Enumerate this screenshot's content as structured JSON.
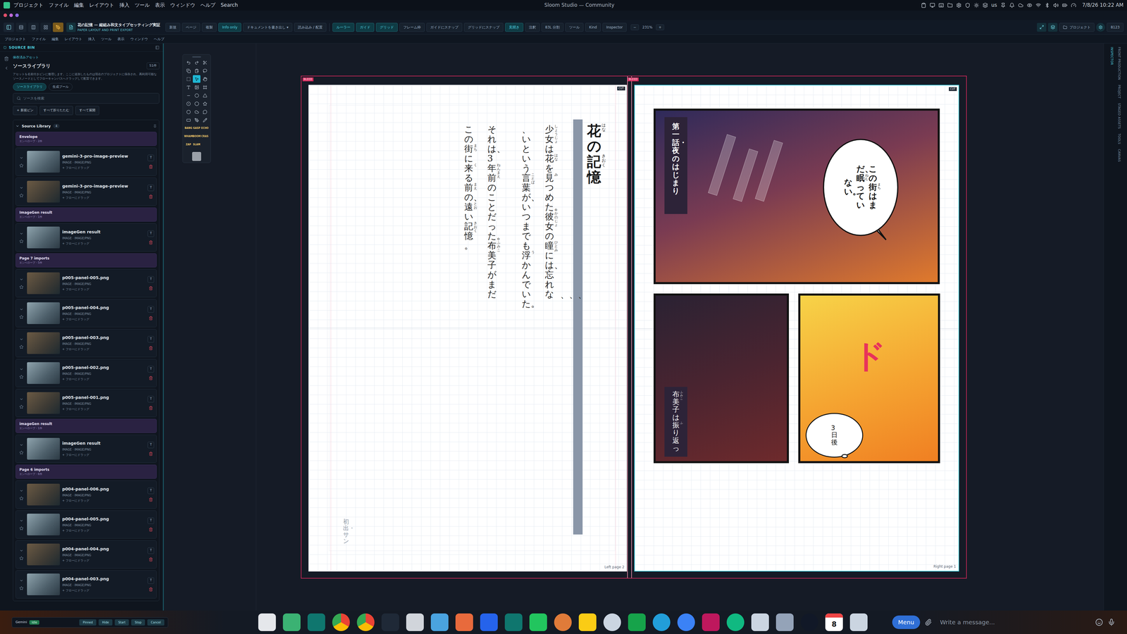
{
  "system_bar": {
    "menus": [
      "プロジェクト",
      "ファイル",
      "編集",
      "レイアウト",
      "挿入",
      "ツール",
      "表示",
      "ウィンドウ",
      "ヘルプ",
      "Search"
    ],
    "title": "Sloom Studio — Community",
    "keyboard": "us",
    "clock": "7/8/26 10:22 AM"
  },
  "toolbar": {
    "doc_title": "花の記憶 — 縦組み和文タイプセッティング実証",
    "doc_subtitle": "PAPER LAYOUT AND PRINT EXPORT",
    "mode_buttons": [
      {
        "selected": false
      },
      {
        "selected": false
      },
      {
        "selected": false
      },
      {
        "selected": true
      }
    ],
    "file_buttons": [
      {
        "label": "新規",
        "on": false
      },
      {
        "label": "ページ",
        "on": false
      },
      {
        "label": "複製",
        "on": false
      },
      {
        "label": "Info only",
        "on": true
      },
      {
        "label": "ドキュメントを書き出し ▾",
        "on": false
      },
      {
        "label": "読み込み / 配置",
        "on": false
      }
    ],
    "view_toggles": [
      {
        "label": "ルーラー",
        "on": true
      },
      {
        "label": "ガイド",
        "on": true
      },
      {
        "label": "グリッド",
        "on": true
      },
      {
        "label": "フレーム枠",
        "on": false
      },
      {
        "label": "ガイドにスナップ",
        "on": false
      },
      {
        "label": "グリッドにスナップ",
        "on": false
      },
      {
        "label": "見開き",
        "on": true
      },
      {
        "label": "注釈",
        "on": false
      },
      {
        "label": "83L 分割",
        "on": false
      },
      {
        "label": "ツール",
        "on": false
      },
      {
        "label": "Kind",
        "on": false
      },
      {
        "label": "Inspector",
        "on": false
      }
    ],
    "zoom": {
      "minus": "−",
      "value": "231%",
      "plus": "+"
    },
    "project": "プロジェクト",
    "counter": "8123"
  },
  "app_menu": [
    "プロジェクト",
    "ファイル",
    "編集",
    "レイアウト",
    "挿入",
    "ツール",
    "表示",
    "ウィンドウ",
    "ヘルプ"
  ],
  "sidebar": {
    "header": "SOURCE BIN",
    "eyebrow": "保存済みアセット",
    "title": "ソースライブラリ",
    "count": "51件",
    "description": "アセットを名前付きピンに整理します。ここに追加したものは現在のプロジェクトに保存され、再利用可能なソースノードとしてフローキャンバスへドラッグして配置できます。",
    "tabs": [
      {
        "label": "ソースライブラリ",
        "selected": true
      },
      {
        "label": "生成プール",
        "selected": false
      }
    ],
    "search_placeholder": "ソースを検索",
    "actions": [
      "+ 新規ピン",
      "すべて折りたたむ",
      "すべて展開"
    ],
    "library": {
      "title": "Source Library",
      "count": "4",
      "item_button": "T",
      "groups": [
        {
          "name": "Envelope",
          "meta": "エンベロープ・2件",
          "items": [
            {
              "name": "gemini-3-pro-image-preview",
              "type": "IMAGE · IMAGE/PNG",
              "hint": "+ フローにドラッグ"
            },
            {
              "name": "gemini-3-pro-image-preview",
              "type": "IMAGE · IMAGE/PNG",
              "hint": "+ フローにドラッグ"
            }
          ]
        },
        {
          "name": "ImageGen result",
          "meta": "エンベロープ・1件",
          "items": [
            {
              "name": "imageGen result",
              "type": "IMAGE · IMAGE/PNG",
              "hint": "+ フローにドラッグ"
            }
          ]
        },
        {
          "name": "Page 7 imports",
          "meta": "エンベロープ・5件",
          "items": [
            {
              "name": "p005-panel-005.png",
              "type": "IMAGE · IMAGE/PNG",
              "hint": "+ フローにドラッグ"
            },
            {
              "name": "p005-panel-004.png",
              "type": "IMAGE · IMAGE/PNG",
              "hint": "+ フローにドラッグ"
            },
            {
              "name": "p005-panel-003.png",
              "type": "IMAGE · IMAGE/PNG",
              "hint": "+ フローにドラッグ"
            },
            {
              "name": "p005-panel-002.png",
              "type": "IMAGE · IMAGE/PNG",
              "hint": "+ フローにドラッグ"
            },
            {
              "name": "p005-panel-001.png",
              "type": "IMAGE · IMAGE/PNG",
              "hint": "+ フローにドラッグ"
            }
          ]
        },
        {
          "name": "imageGen result",
          "meta": "エンベロープ・1件",
          "items": [
            {
              "name": "imageGen result",
              "type": "IMAGE · IMAGE/PNG",
              "hint": "+ フローにドラッグ"
            }
          ]
        },
        {
          "name": "Page 6 imports",
          "meta": "エンベロープ・6件",
          "items": [
            {
              "name": "p004-panel-006.png",
              "type": "IMAGE · IMAGE/PNG",
              "hint": "+ フローにドラッグ"
            },
            {
              "name": "p004-panel-005.png",
              "type": "IMAGE · IMAGE/PNG",
              "hint": "+ フローにドラッグ"
            },
            {
              "name": "p004-panel-004.png",
              "type": "IMAGE · IMAGE/PNG",
              "hint": "+ フローにドラッグ"
            },
            {
              "name": "p004-panel-003.png",
              "type": "IMAGE · IMAGE/PNG",
              "hint": "+ フローにドラッグ"
            }
          ]
        }
      ]
    }
  },
  "tools": {
    "items": [
      {
        "selected": false
      },
      {
        "selected": false
      },
      {
        "selected": false
      },
      {
        "selected": false
      },
      {
        "selected": false
      },
      {
        "selected": false
      },
      {
        "selected": false
      },
      {
        "selected": true
      },
      {
        "selected": false
      },
      {
        "selected": false
      },
      {
        "selected": false
      },
      {
        "selected": false
      },
      {
        "selected": false
      },
      {
        "selected": false
      },
      {
        "selected": false
      },
      {
        "selected": false
      },
      {
        "selected": false
      },
      {
        "selected": false
      },
      {
        "selected": false
      },
      {
        "selected": false
      },
      {
        "selected": false
      },
      {
        "selected": false
      },
      {
        "selected": false
      },
      {
        "selected": false
      }
    ],
    "sfx": [
      "BANG",
      "GASP",
      "ECHO",
      "WHAM",
      "BOOM",
      "CRAS",
      "ZAP",
      "SLAM"
    ]
  },
  "spread": {
    "bleed_label": "BLEED",
    "cut_label": "CUT",
    "left_page": {
      "label": "Left page 2",
      "title": [
        {
          "text": "花",
          "ruby": "はな"
        },
        {
          "text": "の"
        },
        {
          "text": "記憶",
          "ruby": "きおく"
        }
      ],
      "columns": [
        [
          {
            "text": "少女",
            "ruby": "しょうじょ"
          },
          {
            "text": "は"
          },
          {
            "text": "花",
            "ruby": "はな"
          },
          {
            "text": "を"
          },
          {
            "text": "見",
            "ruby": "み"
          },
          {
            "text": "つめた。"
          },
          {
            "text": "彼女",
            "ruby": "かのじょ"
          },
          {
            "text": "の"
          },
          {
            "text": "瞳",
            "ruby": "ひとみ"
          },
          {
            "text": "には、忘れな"
          }
        ],
        [
          {
            "text": "、いという"
          },
          {
            "text": "言葉",
            "ruby": "ことば"
          },
          {
            "text": "が、いつまでも"
          },
          {
            "text": "浮",
            "ruby": "う"
          },
          {
            "text": "かんでいた。"
          }
        ],
        [
          {
            "text": "それは、3"
          },
          {
            "text": "年前",
            "ruby": "ねんまえ"
          },
          {
            "text": "のことだった。"
          },
          {
            "text": "布美子",
            "ruby": "ふみこ"
          },
          {
            "text": "がまだ"
          }
        ],
        [
          {
            "text": "この"
          },
          {
            "text": "街",
            "ruby": "まち"
          },
          {
            "text": "に"
          },
          {
            "text": "来",
            "ruby": "く"
          },
          {
            "text": "る"
          },
          {
            "text": "前",
            "ruby": "まえ"
          },
          {
            "text": "の、"
          },
          {
            "text": "遠",
            "ruby": "とお"
          },
          {
            "text": "い"
          },
          {
            "text": "記憶",
            "ruby": "きおく"
          },
          {
            "text": "。"
          }
        ]
      ],
      "marks": "、、、",
      "credit": "初出・サン"
    },
    "right_page": {
      "label": "Right page 1",
      "chapter": "第一話・夜のはじまり",
      "bubble": [
        [
          {
            "text": "この"
          },
          {
            "text": "街",
            "ruby": "まち"
          },
          {
            "text": "はま"
          }
        ],
        [
          {
            "text": "だ、"
          },
          {
            "text": "眠",
            "ruby": "ねむ"
          },
          {
            "text": "ってい"
          }
        ],
        [
          {
            "text": "ない。"
          }
        ]
      ],
      "caption": [
        {
          "text": "布美子",
          "ruby": "ふみこ"
        },
        {
          "text": "は"
        },
        {
          "text": "振",
          "ruby": "ふ"
        },
        {
          "text": "り返っ"
        }
      ],
      "sfx": "ド",
      "thought": "3日後"
    }
  },
  "right_rail": {
    "inner": [
      "INSPECTOR"
    ],
    "outer": [
      "FRONT PRODUCTION",
      "PROJECT",
      "STAGED ASSETS",
      "TOOLS",
      "CANVAS"
    ]
  },
  "taskbar": {
    "agent": {
      "name": "Gemini",
      "status": "Idle",
      "buttons": [
        "Pinned",
        "Hide",
        "Start",
        "Stop",
        "Cancel"
      ]
    },
    "calendar_day": "8",
    "menu": "Menu",
    "message_placeholder": "Write a message..."
  }
}
